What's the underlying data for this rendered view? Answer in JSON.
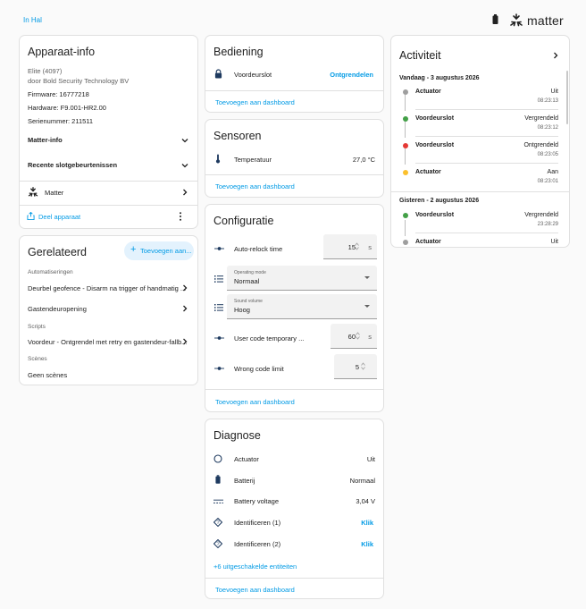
{
  "breadcrumb": "In Hal",
  "brand": {
    "name": "matter"
  },
  "colors": {
    "accent": "#039be5",
    "green": "#43a047",
    "red": "#e53935",
    "yellow": "#fbc02d",
    "grey": "#9e9e9e",
    "lock_blue": "#1e3a5f"
  },
  "device_info": {
    "title": "Apparaat-info",
    "model": "Elite (4097)",
    "manufacturer": "door Bold Security Technology BV",
    "firmware": "Firmware: 16777218",
    "hardware": "Hardware: F9.001-HR2.00",
    "serial": "Serienummer: 211511",
    "expanders": [
      "Matter-info",
      "Recente slotgebeurtenissen"
    ],
    "matter_link": "Matter",
    "share": "Deel apparaat"
  },
  "related": {
    "title": "Gerelateerd",
    "add_button": "Toevoegen aan...",
    "automations_header": "Automatiseringen",
    "automations": [
      "Deurbel geofence - Disarm na trigger of handmatig ...",
      "Gastendeuropening"
    ],
    "scripts_header": "Scripts",
    "scripts": [
      "Voordeur - Ontgrendel met retry en gastendeur-fallb..."
    ],
    "scenes_header": "Scènes",
    "scenes_value": "Geen scènes"
  },
  "controls": {
    "title": "Bediening",
    "entity": "Voordeurslot",
    "action": "Ontgrendelen",
    "add_dashboard": "Toevoegen aan dashboard"
  },
  "sensors": {
    "title": "Sensoren",
    "entity": "Temperatuur",
    "value": "27,0 °C",
    "add_dashboard": "Toevoegen aan dashboard"
  },
  "config": {
    "title": "Configuratie",
    "autorelock_label": "Auto-relock time",
    "autorelock_value": "15",
    "autorelock_unit": "s",
    "operating_label": "Operating mode",
    "operating_value": "Normaal",
    "sound_label": "Sound volume",
    "sound_value": "Hoog",
    "usercode_label": "User code temporary ...",
    "usercode_value": "60",
    "usercode_unit": "s",
    "wrongcode_label": "Wrong code limit",
    "wrongcode_value": "5",
    "add_dashboard": "Toevoegen aan dashboard"
  },
  "diagnostics": {
    "title": "Diagnose",
    "rows": [
      {
        "label": "Actuator",
        "value": "Uit"
      },
      {
        "label": "Batterij",
        "value": "Normaal"
      },
      {
        "label": "Battery voltage",
        "value": "3,04 V"
      },
      {
        "label": "Identificeren (1)",
        "value": "Klik"
      },
      {
        "label": "Identificeren (2)",
        "value": "Klik"
      }
    ],
    "disabled": "+6 uitgeschakelde entiteiten",
    "add_dashboard": "Toevoegen aan dashboard"
  },
  "activity": {
    "title": "Activiteit",
    "today_header": "Vandaag - 3 augustus 2026",
    "today": [
      {
        "name": "Actuator",
        "state": "Uit",
        "time": "08:23:13",
        "color": "grey"
      },
      {
        "name": "Voordeurslot",
        "state": "Vergrendeld",
        "time": "08:23:12",
        "color": "green"
      },
      {
        "name": "Voordeurslot",
        "state": "Ontgrendeld",
        "time": "08:23:05",
        "color": "red"
      },
      {
        "name": "Actuator",
        "state": "Aan",
        "time": "08:23:01",
        "color": "yellow"
      }
    ],
    "yesterday_header": "Gisteren - 2 augustus 2026",
    "yesterday": [
      {
        "name": "Voordeurslot",
        "state": "Vergrendeld",
        "time": "23:28:29",
        "color": "green"
      },
      {
        "name": "Actuator",
        "state": "Uit",
        "color": "grey"
      }
    ]
  }
}
